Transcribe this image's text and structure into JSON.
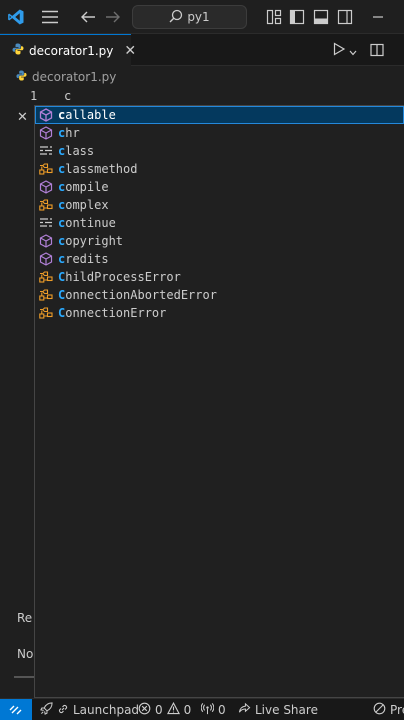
{
  "titlebar": {
    "search_text": "py1",
    "icons": [
      "vscode-logo-icon",
      "menu-icon",
      "back-arrow-icon",
      "forward-arrow-icon",
      "search-icon",
      "customize-layout-icon",
      "toggle-primary-sidebar-icon",
      "toggle-panel-icon",
      "toggle-secondary-sidebar-icon",
      "minimize-icon"
    ]
  },
  "tab": {
    "label": "decorator1.py",
    "close": "✕"
  },
  "breadcrumb": {
    "file": "decorator1.py"
  },
  "editor": {
    "line_number": "1",
    "code": "c"
  },
  "side_panel": {
    "close": "✕",
    "text1": "Re",
    "text2": "No"
  },
  "suggestions": [
    {
      "match": "c",
      "rest": "allable",
      "kind": "class-icon",
      "selected": true
    },
    {
      "match": "c",
      "rest": "hr",
      "kind": "method-icon",
      "selected": false
    },
    {
      "match": "c",
      "rest": "lass",
      "kind": "keyword-icon",
      "selected": false
    },
    {
      "match": "c",
      "rest": "lassmethod",
      "kind": "class-type-icon",
      "selected": false
    },
    {
      "match": "c",
      "rest": "ompile",
      "kind": "method-icon",
      "selected": false
    },
    {
      "match": "c",
      "rest": "omplex",
      "kind": "class-type-icon",
      "selected": false
    },
    {
      "match": "c",
      "rest": "ontinue",
      "kind": "keyword-icon",
      "selected": false
    },
    {
      "match": "c",
      "rest": "opyright",
      "kind": "method-icon",
      "selected": false
    },
    {
      "match": "c",
      "rest": "redits",
      "kind": "method-icon",
      "selected": false
    },
    {
      "match": "C",
      "rest": "hildProcessError",
      "kind": "class-type-icon",
      "selected": false
    },
    {
      "match": "C",
      "rest": "onnectionAbortedError",
      "kind": "class-type-icon",
      "selected": false
    },
    {
      "match": "C",
      "rest": "onnectionError",
      "kind": "class-type-icon",
      "selected": false
    }
  ],
  "statusbar": {
    "launchpad": "Launchpad",
    "errors": "0",
    "warnings": "0",
    "ports": "0",
    "live_share": "Live Share",
    "prettier": "Pre"
  },
  "colors": {
    "accent": "#0078d4",
    "selected_bg": "#04395e",
    "match": "#2aaaff",
    "class_icon": "#b180d7",
    "type_icon": "#ee9d28"
  }
}
